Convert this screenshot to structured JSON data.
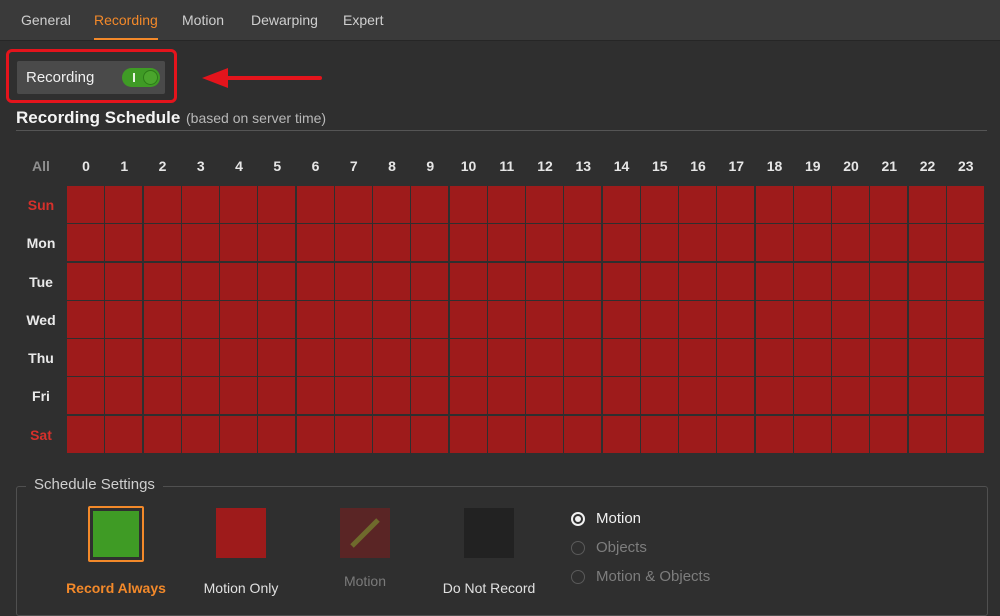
{
  "tabs": [
    {
      "label": "General",
      "active": false
    },
    {
      "label": "Recording",
      "active": true
    },
    {
      "label": "Motion",
      "active": false
    },
    {
      "label": "Dewarping",
      "active": false
    },
    {
      "label": "Expert",
      "active": false
    }
  ],
  "recording_toggle": {
    "label": "Recording",
    "on": true
  },
  "schedule": {
    "title": "Recording Schedule",
    "subtitle": "(based on server time)",
    "all_label": "All",
    "hours": [
      "0",
      "1",
      "2",
      "3",
      "4",
      "5",
      "6",
      "7",
      "8",
      "9",
      "10",
      "11",
      "12",
      "13",
      "14",
      "15",
      "16",
      "17",
      "18",
      "19",
      "20",
      "21",
      "22",
      "23"
    ],
    "days": [
      {
        "label": "Sun",
        "weekend": true
      },
      {
        "label": "Mon",
        "weekend": false
      },
      {
        "label": "Tue",
        "weekend": false
      },
      {
        "label": "Wed",
        "weekend": false
      },
      {
        "label": "Thu",
        "weekend": false
      },
      {
        "label": "Fri",
        "weekend": false
      },
      {
        "label": "Sat",
        "weekend": true
      }
    ],
    "cell_mode": "motion_only"
  },
  "settings": {
    "legend": "Schedule Settings",
    "modes": [
      {
        "id": "record_always",
        "label": "Record Always",
        "selected": true,
        "disabled": false
      },
      {
        "id": "motion_only",
        "label": "Motion Only",
        "selected": false,
        "disabled": false
      },
      {
        "id": "motion_lowres",
        "label": "Motion",
        "selected": false,
        "disabled": true
      },
      {
        "id": "do_not_record",
        "label": "Do Not Record",
        "selected": false,
        "disabled": false
      }
    ],
    "detection_options": [
      {
        "label": "Motion",
        "checked": true,
        "disabled": false
      },
      {
        "label": "Objects",
        "checked": false,
        "disabled": true
      },
      {
        "label": "Motion & Objects",
        "checked": false,
        "disabled": true
      }
    ]
  },
  "colors": {
    "accent": "#f3892a",
    "record_always": "#3f9b25",
    "motion_only": "#9e1b1b",
    "motion_disabled": "#5a2525",
    "do_not_record": "#222222",
    "highlight": "#e4141c"
  }
}
